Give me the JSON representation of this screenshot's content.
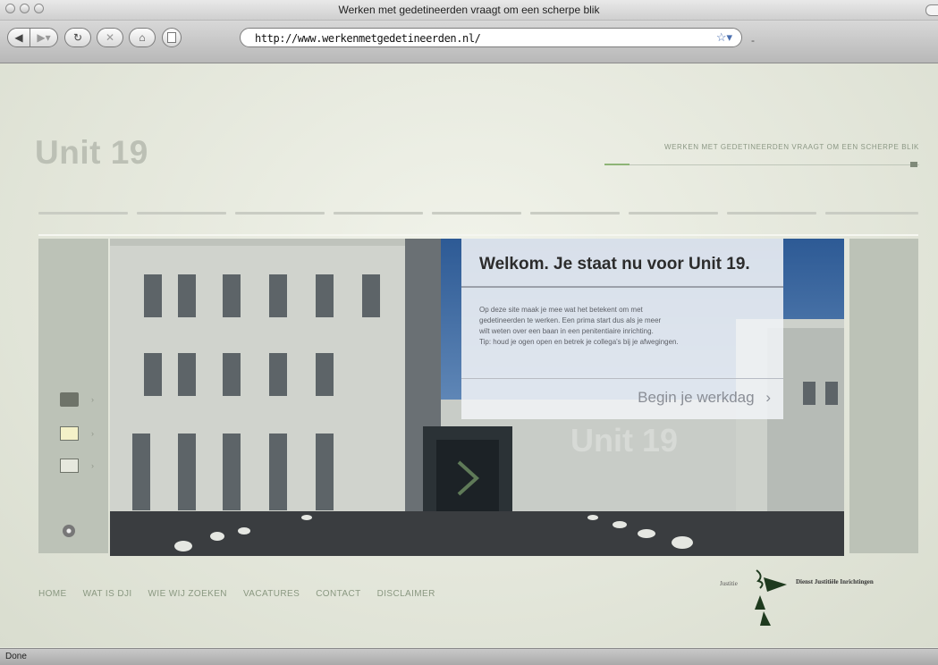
{
  "window": {
    "title": "Werken met gedetineerden vraagt om een scherpe blik"
  },
  "toolbar": {
    "url": "http://www.werkenmetgedetineerden.nl/",
    "back_icon": "back-arrow-icon",
    "forward_icon": "forward-arrow-icon",
    "reload_icon": "reload-icon",
    "stop_icon": "stop-icon",
    "home_icon": "home-icon",
    "bookmark_icon": "star-icon"
  },
  "site": {
    "logo": "Unit 19",
    "tagline": "WERKEN MET GEDETINEERDEN VRAAGT OM EEN SCHERPE BLIK",
    "watermark": "Unit 19",
    "accent_color": "#8eb476"
  },
  "welcome": {
    "title": "Welkom. Je staat nu voor Unit 19.",
    "body_lines": [
      "Op deze site maak je mee wat het betekent om met",
      "gedetineerden te werken. Een prima start dus als je meer",
      "wilt weten over een baan in een penitentiaire inrichting.",
      "Tip: houd je ogen open en betrek je collega's bij je afwegingen."
    ],
    "cta": "Begin je werkdag",
    "cta_chevron": "›"
  },
  "side_icons": [
    "folder-icon",
    "book-icon",
    "document-icon",
    "disc-icon"
  ],
  "footer": {
    "nav": [
      "HOME",
      "WAT IS DJI",
      "WIE WIJ ZOEKEN",
      "VACATURES",
      "CONTACT",
      "DISCLAIMER"
    ],
    "justitie": "Justitie",
    "agency": "Dienst Justitiële Inrichtingen"
  },
  "status": {
    "text": "Done"
  }
}
